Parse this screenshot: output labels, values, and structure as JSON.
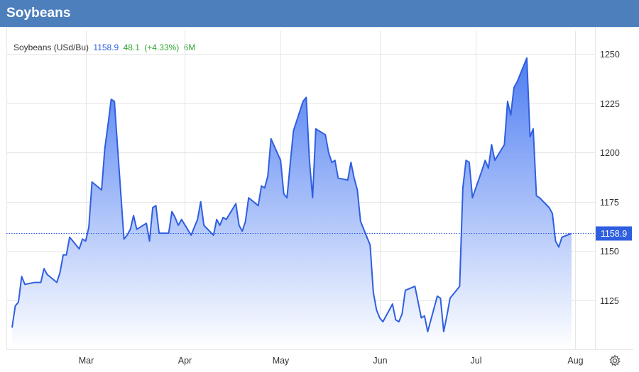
{
  "header": {
    "title": "Soybeans"
  },
  "legend": {
    "name": "Soybeans (USd/Bu)",
    "price": "1158.9",
    "change": "48.1",
    "change_pct": "(+4.33%)",
    "period": "6M"
  },
  "colors": {
    "header_bg": "#4e7fbd",
    "line": "#2f5fe0",
    "fill_top": "#4f7ef2",
    "fill_bottom": "#ffffff",
    "price_label_bg": "#2f5fe0",
    "price_text": "#2f5fe0",
    "change_text": "#33a833",
    "grid": "#e6e6e6"
  },
  "chart_data": {
    "type": "area",
    "title": "Soybeans (USd/Bu)",
    "xlabel": "",
    "ylabel": "",
    "ylim": [
      1100,
      1262
    ],
    "yticks": [
      1125,
      1150,
      1175,
      1200,
      1225,
      1250
    ],
    "x_tick_labels": [
      "Mar",
      "Apr",
      "May",
      "Jun",
      "Jul",
      "Aug"
    ],
    "last_value": 1158.9,
    "last_value_label": "1158.9",
    "grid": true,
    "series": [
      {
        "points": [
          [
            "2023-02-06",
            1111
          ],
          [
            "2023-02-07",
            1122
          ],
          [
            "2023-02-08",
            1124
          ],
          [
            "2023-02-09",
            1137
          ],
          [
            "2023-02-10",
            1133
          ],
          [
            "2023-02-13",
            1134
          ],
          [
            "2023-02-14",
            1134
          ],
          [
            "2023-02-15",
            1134
          ],
          [
            "2023-02-16",
            1141
          ],
          [
            "2023-02-17",
            1138
          ],
          [
            "2023-02-20",
            1134
          ],
          [
            "2023-02-21",
            1139
          ],
          [
            "2023-02-22",
            1148
          ],
          [
            "2023-02-23",
            1148
          ],
          [
            "2023-02-24",
            1157
          ],
          [
            "2023-02-27",
            1151
          ],
          [
            "2023-02-28",
            1156
          ],
          [
            "2023-03-01",
            1155
          ],
          [
            "2023-03-02",
            1162
          ],
          [
            "2023-03-03",
            1185
          ],
          [
            "2023-03-06",
            1181
          ],
          [
            "2023-03-07",
            1202
          ],
          [
            "2023-03-08",
            1214
          ],
          [
            "2023-03-09",
            1227
          ],
          [
            "2023-03-10",
            1226
          ],
          [
            "2023-03-13",
            1156
          ],
          [
            "2023-03-14",
            1158
          ],
          [
            "2023-03-15",
            1161
          ],
          [
            "2023-03-16",
            1168
          ],
          [
            "2023-03-17",
            1161
          ],
          [
            "2023-03-20",
            1164
          ],
          [
            "2023-03-21",
            1155
          ],
          [
            "2023-03-22",
            1172
          ],
          [
            "2023-03-23",
            1173
          ],
          [
            "2023-03-24",
            1159
          ],
          [
            "2023-03-27",
            1159
          ],
          [
            "2023-03-28",
            1170
          ],
          [
            "2023-03-29",
            1167
          ],
          [
            "2023-03-30",
            1163
          ],
          [
            "2023-03-31",
            1166
          ],
          [
            "2023-04-03",
            1158
          ],
          [
            "2023-04-04",
            1162
          ],
          [
            "2023-04-05",
            1166
          ],
          [
            "2023-04-06",
            1175
          ],
          [
            "2023-04-07",
            1163
          ],
          [
            "2023-04-10",
            1158
          ],
          [
            "2023-04-11",
            1166
          ],
          [
            "2023-04-12",
            1163
          ],
          [
            "2023-04-13",
            1167
          ],
          [
            "2023-04-14",
            1166
          ],
          [
            "2023-04-17",
            1174
          ],
          [
            "2023-04-18",
            1163
          ],
          [
            "2023-04-19",
            1160
          ],
          [
            "2023-04-20",
            1165
          ],
          [
            "2023-04-21",
            1177
          ],
          [
            "2023-04-24",
            1173
          ],
          [
            "2023-04-25",
            1183
          ],
          [
            "2023-04-26",
            1182
          ],
          [
            "2023-04-27",
            1188
          ],
          [
            "2023-04-28",
            1207
          ],
          [
            "2023-05-01",
            1196
          ],
          [
            "2023-05-02",
            1179
          ],
          [
            "2023-05-03",
            1177
          ],
          [
            "2023-05-04",
            1194
          ],
          [
            "2023-05-05",
            1211
          ],
          [
            "2023-05-08",
            1226
          ],
          [
            "2023-05-09",
            1228
          ],
          [
            "2023-05-10",
            1196
          ],
          [
            "2023-05-11",
            1177
          ],
          [
            "2023-05-12",
            1212
          ],
          [
            "2023-05-15",
            1209
          ],
          [
            "2023-05-16",
            1200
          ],
          [
            "2023-05-17",
            1195
          ],
          [
            "2023-05-18",
            1196
          ],
          [
            "2023-05-19",
            1187
          ],
          [
            "2023-05-22",
            1186
          ],
          [
            "2023-05-23",
            1195
          ],
          [
            "2023-05-24",
            1187
          ],
          [
            "2023-05-25",
            1181
          ],
          [
            "2023-05-26",
            1165
          ],
          [
            "2023-05-29",
            1153
          ],
          [
            "2023-05-30",
            1129
          ],
          [
            "2023-05-31",
            1120
          ],
          [
            "2023-06-01",
            1116
          ],
          [
            "2023-06-02",
            1114
          ],
          [
            "2023-06-05",
            1123
          ],
          [
            "2023-06-06",
            1115
          ],
          [
            "2023-06-07",
            1114
          ],
          [
            "2023-06-08",
            1118
          ],
          [
            "2023-06-09",
            1130
          ],
          [
            "2023-06-12",
            1132
          ],
          [
            "2023-06-13",
            1124
          ],
          [
            "2023-06-14",
            1116
          ],
          [
            "2023-06-15",
            1117
          ],
          [
            "2023-06-16",
            1109
          ],
          [
            "2023-06-19",
            1127
          ],
          [
            "2023-06-20",
            1126
          ],
          [
            "2023-06-21",
            1109
          ],
          [
            "2023-06-22",
            1117
          ],
          [
            "2023-06-23",
            1126
          ],
          [
            "2023-06-26",
            1132
          ],
          [
            "2023-06-27",
            1182
          ],
          [
            "2023-06-28",
            1196
          ],
          [
            "2023-06-29",
            1195
          ],
          [
            "2023-06-30",
            1177
          ],
          [
            "2023-07-03",
            1191
          ],
          [
            "2023-07-04",
            1196
          ],
          [
            "2023-07-05",
            1192
          ],
          [
            "2023-07-06",
            1204
          ],
          [
            "2023-07-07",
            1196
          ],
          [
            "2023-07-10",
            1204
          ],
          [
            "2023-07-11",
            1226
          ],
          [
            "2023-07-12",
            1219
          ],
          [
            "2023-07-13",
            1233
          ],
          [
            "2023-07-14",
            1236
          ],
          [
            "2023-07-17",
            1248
          ],
          [
            "2023-07-18",
            1208
          ],
          [
            "2023-07-19",
            1212
          ],
          [
            "2023-07-20",
            1178
          ],
          [
            "2023-07-21",
            1177
          ],
          [
            "2023-07-24",
            1172
          ],
          [
            "2023-07-25",
            1169
          ],
          [
            "2023-07-26",
            1155
          ],
          [
            "2023-07-27",
            1152
          ],
          [
            "2023-07-28",
            1157
          ],
          [
            "2023-07-31",
            1158.9
          ]
        ]
      }
    ]
  }
}
